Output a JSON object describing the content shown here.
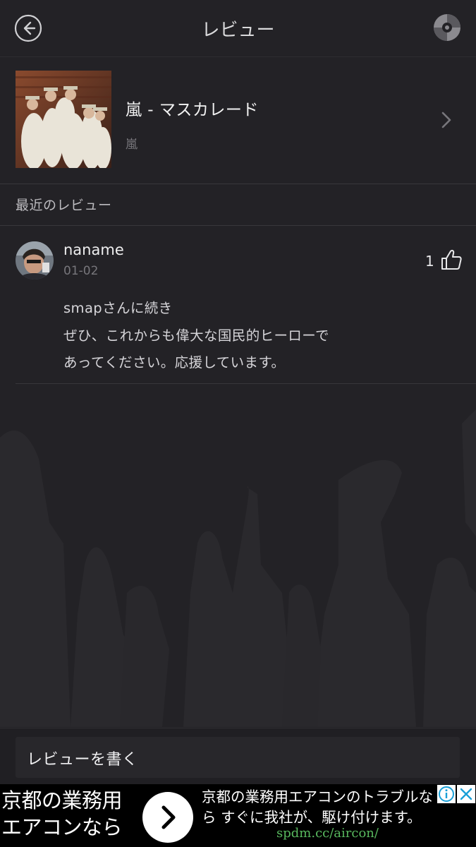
{
  "header": {
    "title": "レビュー",
    "back_icon": "back-arrow-circle-icon",
    "right_icon": "disc-icon"
  },
  "song": {
    "title": "嵐 - マスカレード",
    "artist": "嵐"
  },
  "section": {
    "title": "最近のレビュー"
  },
  "reviews": [
    {
      "user": "naname",
      "date": "01-02",
      "likes": "1",
      "text": [
        "smapさんに続き",
        "ぜひ、これからも偉大な国民的ヒーローで",
        "あってください。応援しています。"
      ]
    }
  ],
  "bottom": {
    "write_label": "レビューを書く"
  },
  "ad": {
    "left_line1": "京都の業務用",
    "left_line2": "エアコンなら",
    "right_line1": "京都の業務用エアコンのトラブルな",
    "right_line2": "ら すぐに我社が、駆け付けます。",
    "url": "spdm.cc/aircon/"
  },
  "colors": {
    "background": "#232226",
    "divider": "#38373b",
    "secondary_text": "#77767b",
    "ad_url": "#58b85e"
  }
}
